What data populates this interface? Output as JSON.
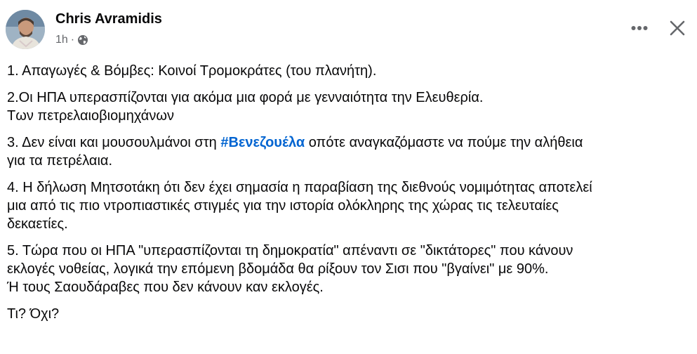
{
  "author": {
    "name": "Chris Avramidis",
    "time": "1h",
    "separator": "·",
    "audience_icon": "globe-icon"
  },
  "actions": {
    "more_icon": "more-horizontal-icon",
    "close_icon": "close-icon"
  },
  "post": {
    "p1": "1. Απαγωγές & Βόμβες: Κοινοί Τρομοκράτες (του πλανήτη).",
    "p2_line1": "2.Οι ΗΠΑ υπερασπίζονται για ακόμα μια φορά με γενναιότητα την Ελευθερία.",
    "p2_line2": "Των πετρελαιοβιομηχάνων",
    "p3_before": "3. Δεν είναι και μουσουλμάνοι στη ",
    "p3_hashtag": "#Βενεζουέλα",
    "p3_after": " οπότε αναγκαζόμαστε να πούμε την αλήθεια",
    "p3_line2": "για τα πετρέλαια.",
    "p4_line1": "4. Η δήλωση Μητσοτάκη ότι δεν έχει σημασία η παραβίαση της διεθνούς νομιμότητας αποτελεί",
    "p4_line2": "μια από τις πιο ντροπιαστικές στιγμές για την ιστορία ολόκληρης της χώρας τις τελευταίες",
    "p4_line3": "δεκαετίες.",
    "p5_line1": "5. Τώρα που οι ΗΠΑ \"υπερασπίζονται τη δημοκρατία\" απέναντι σε \"δικτάτορες\" που κάνουν",
    "p5_line2": "εκλογές νοθείας, λογικά την επόμενη βδομάδα θα ρίξουν τον Σισι που \"βγαίνει\"  με 90%.",
    "p5_line3": "Ή τους Σαουδάραβες που δεν κάνουν καν εκλογές.",
    "p6": "Τι? Όχι?"
  },
  "colors": {
    "text": "#080809",
    "secondary": "#65676b",
    "hashtag": "#0064d1"
  }
}
